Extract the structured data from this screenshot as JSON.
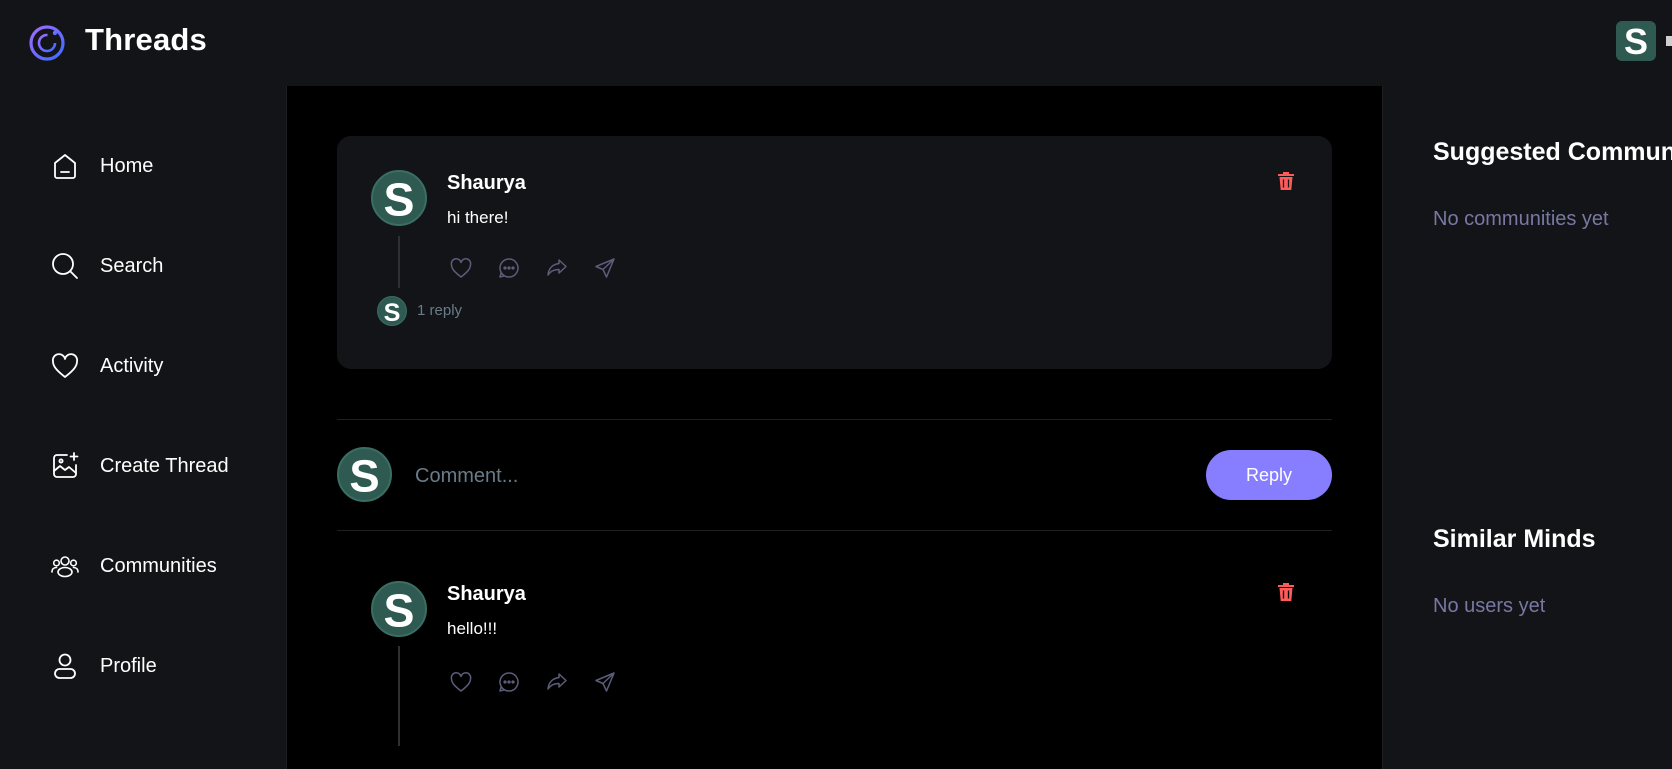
{
  "app": {
    "title": "Threads"
  },
  "colors": {
    "accent": "#877eff",
    "danger": "#ff5a5a",
    "avatar_bg": "#2e5a52",
    "muted": "#7878a3"
  },
  "nav": {
    "items": [
      {
        "label": "Home",
        "icon": "home-icon"
      },
      {
        "label": "Search",
        "icon": "search-icon"
      },
      {
        "label": "Activity",
        "icon": "heart-icon"
      },
      {
        "label": "Create Thread",
        "icon": "create-thread-icon"
      },
      {
        "label": "Communities",
        "icon": "communities-icon"
      },
      {
        "label": "Profile",
        "icon": "user-icon"
      }
    ]
  },
  "user": {
    "avatar_letter": "S"
  },
  "thread": {
    "author": "Shaurya",
    "content": "hi there!",
    "replies_text": "1 reply"
  },
  "comment_form": {
    "placeholder": "Comment...",
    "submit_label": "Reply"
  },
  "comments": [
    {
      "author": "Shaurya",
      "content": "hello!!!"
    }
  ],
  "rightbar": {
    "communities_title": "Suggested Communities",
    "communities_empty": "No communities yet",
    "users_title": "Similar Minds",
    "users_empty": "No users yet"
  }
}
